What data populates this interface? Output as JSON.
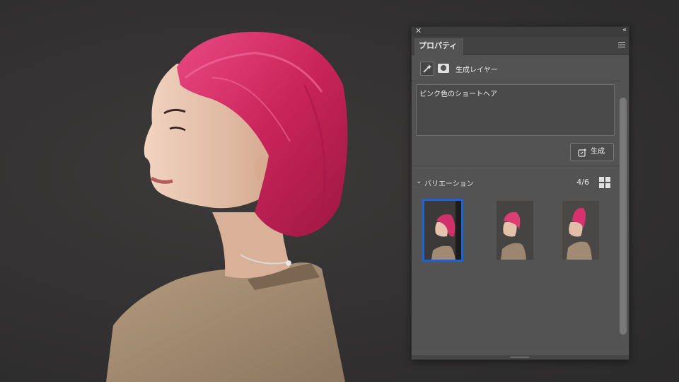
{
  "panel": {
    "title": "プロパティ",
    "layer_type_label": "生成レイヤー",
    "prompt_text": "ピンク色のショートヘア",
    "generate_label": "生成",
    "variations": {
      "title": "バリエーション",
      "count": "4/6",
      "items": [
        {
          "hair": "bob",
          "selected": true
        },
        {
          "hair": "short",
          "selected": false
        },
        {
          "hair": "mohawk",
          "selected": false
        }
      ]
    }
  },
  "icons": {
    "close": "close-icon",
    "collapse": "double-chevron-icon",
    "menu": "hamburger-menu-icon",
    "generative": "sparkle-wand-icon",
    "mask": "layer-mask-icon",
    "generate": "generate-icon",
    "chevron": "chevron-down-icon",
    "grid": "grid-view-icon"
  },
  "colors": {
    "selection": "#1d63d8",
    "hair": "#d8336b",
    "panel_bg": "#535353"
  }
}
